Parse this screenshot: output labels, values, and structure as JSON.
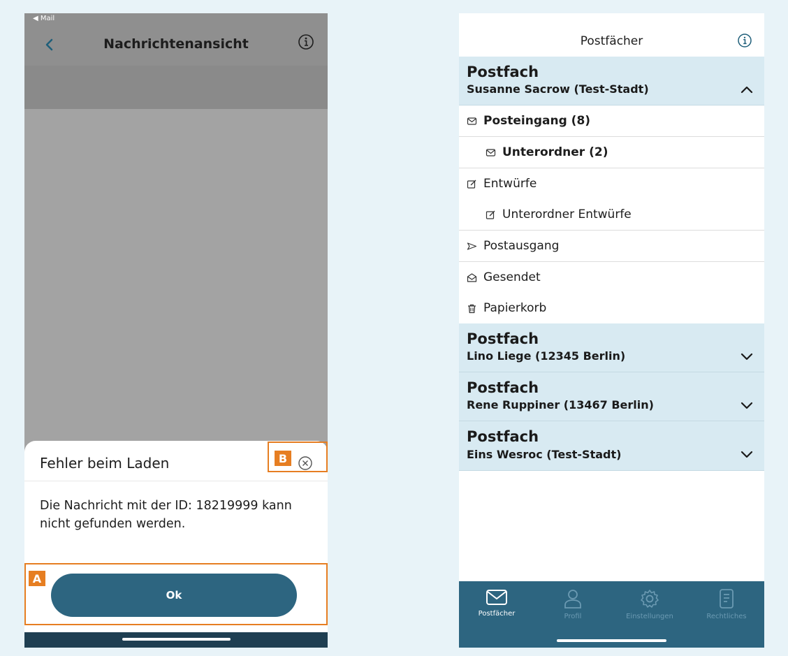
{
  "left": {
    "status_text": "◀ Mail",
    "title": "Nachrichtenansicht",
    "dialog": {
      "title": "Fehler beim Laden",
      "message": "Die Nachricht mit der ID: 18219999 kann nicht gefunden werden.",
      "ok_label": "Ok"
    },
    "annotations": {
      "a": "A",
      "b": "B"
    }
  },
  "right": {
    "title": "Postfächer",
    "mailboxes": [
      {
        "heading": "Postfach",
        "owner": "Susanne Sacrow (Test-Stadt)",
        "expanded": true
      },
      {
        "heading": "Postfach",
        "owner": "Lino Liege (12345 Berlin)",
        "expanded": false
      },
      {
        "heading": "Postfach",
        "owner": "Rene Ruppiner (13467 Berlin)",
        "expanded": false
      },
      {
        "heading": "Postfach",
        "owner": "Eins Wesroc (Test-Stadt)",
        "expanded": false
      }
    ],
    "folders": [
      {
        "label": "Posteingang (8)",
        "icon": "envelope-icon",
        "bold": true
      },
      {
        "label": "Unterordner (2)",
        "icon": "envelope-icon",
        "bold": true
      },
      {
        "label": "Entwürfe",
        "icon": "edit-icon",
        "bold": false
      },
      {
        "label": "Unterordner Entwürfe",
        "icon": "edit-icon",
        "bold": false
      },
      {
        "label": "Postausgang",
        "icon": "send-icon",
        "bold": false
      },
      {
        "label": "Gesendet",
        "icon": "open-envelope-icon",
        "bold": false
      },
      {
        "label": "Papierkorb",
        "icon": "trash-icon",
        "bold": false
      }
    ],
    "tabs": [
      {
        "label": "Postfächer",
        "icon": "mail-icon",
        "active": true
      },
      {
        "label": "Profil",
        "icon": "person-icon",
        "active": false
      },
      {
        "label": "Einstellungen",
        "icon": "gear-icon",
        "active": false
      },
      {
        "label": "Rechtliches",
        "icon": "document-icon",
        "active": false
      }
    ]
  },
  "colors": {
    "brand": "#2d6580",
    "accordion_bg": "#d8eaf2",
    "annotation": "#e67e22",
    "overlay_gray": "#a3a3a3"
  }
}
